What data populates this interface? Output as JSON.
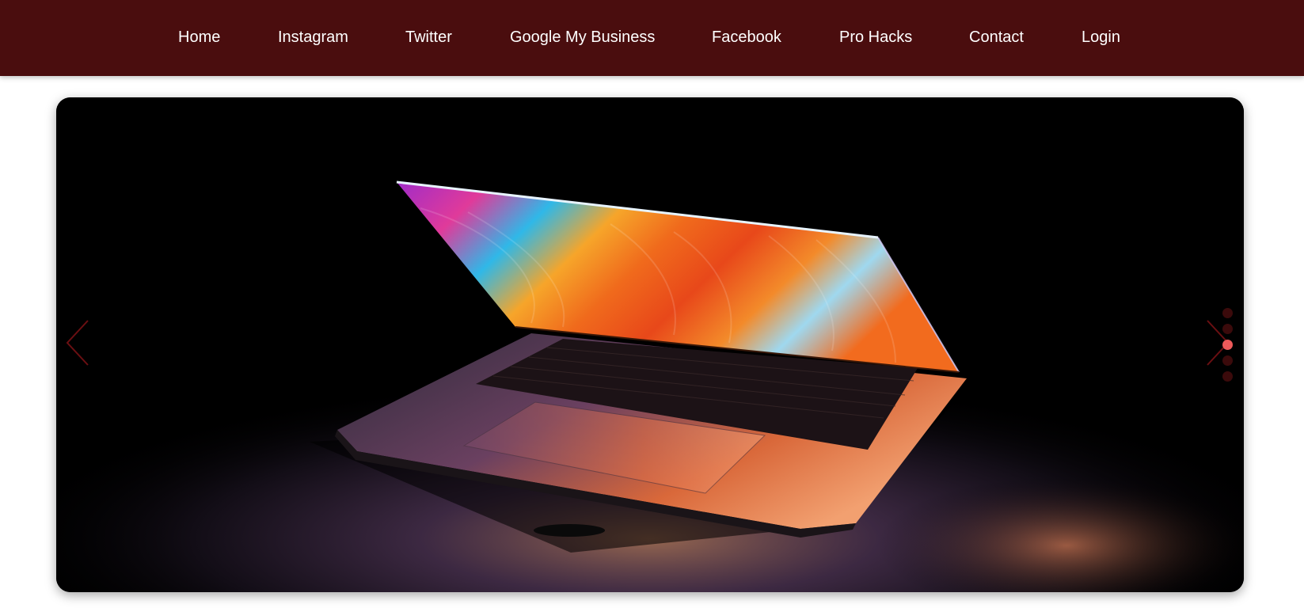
{
  "nav": {
    "items": [
      {
        "label": "Home"
      },
      {
        "label": "Instagram"
      },
      {
        "label": "Twitter"
      },
      {
        "label": "Google My Business"
      },
      {
        "label": "Facebook"
      },
      {
        "label": "Pro Hacks"
      },
      {
        "label": "Contact"
      },
      {
        "label": "Login"
      }
    ]
  },
  "slider": {
    "image_subject": "laptop-photo",
    "dot_count": 5,
    "active_dot": 3,
    "colors": {
      "nav_bg": "#4a0d0e",
      "arrow": "#6b0f12",
      "dot_inactive": "#3b0a0b",
      "dot_active": "#ee5a5a"
    }
  }
}
